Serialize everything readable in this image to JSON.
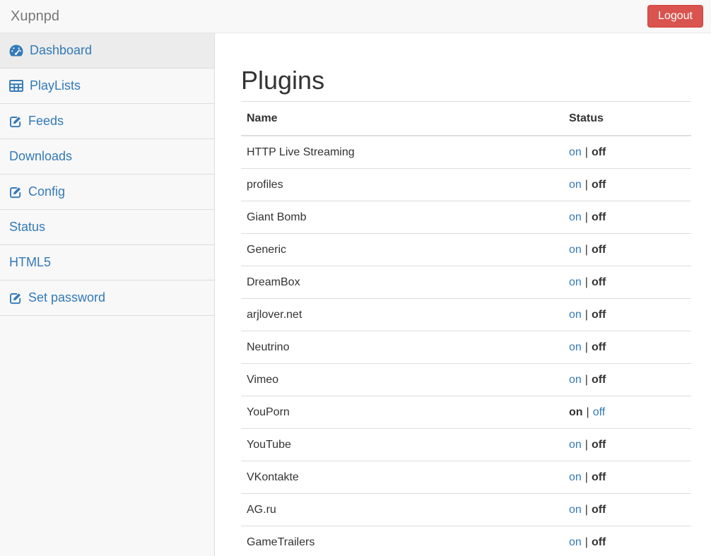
{
  "header": {
    "brand": "Xupnpd",
    "logout_label": "Logout"
  },
  "sidebar": {
    "items": [
      {
        "label": "Dashboard",
        "icon": "dashboard-icon",
        "active": true
      },
      {
        "label": "PlayLists",
        "icon": "table-icon",
        "active": false
      },
      {
        "label": "Feeds",
        "icon": "edit-icon",
        "active": false
      },
      {
        "label": "Downloads",
        "icon": "",
        "active": false
      },
      {
        "label": "Config",
        "icon": "edit-icon",
        "active": false
      },
      {
        "label": "Status",
        "icon": "",
        "active": false
      },
      {
        "label": "HTML5",
        "icon": "",
        "active": false
      },
      {
        "label": "Set password",
        "icon": "edit-icon",
        "active": false
      }
    ]
  },
  "main": {
    "title": "Plugins",
    "table": {
      "columns": [
        "Name",
        "Status"
      ],
      "on_label": "on",
      "off_label": "off",
      "separator": "|",
      "rows": [
        {
          "name": "HTTP Live Streaming",
          "enabled": false
        },
        {
          "name": "profiles",
          "enabled": false
        },
        {
          "name": "Giant Bomb",
          "enabled": false
        },
        {
          "name": "Generic",
          "enabled": false
        },
        {
          "name": "DreamBox",
          "enabled": false
        },
        {
          "name": "arjlover.net",
          "enabled": false
        },
        {
          "name": "Neutrino",
          "enabled": false
        },
        {
          "name": "Vimeo",
          "enabled": false
        },
        {
          "name": "YouPorn",
          "enabled": true
        },
        {
          "name": "YouTube",
          "enabled": false
        },
        {
          "name": "VKontakte",
          "enabled": false
        },
        {
          "name": "AG.ru",
          "enabled": false
        },
        {
          "name": "GameTrailers",
          "enabled": false
        }
      ]
    }
  },
  "colors": {
    "accent_link": "#337ab7",
    "danger_bg": "#d9534f",
    "danger_border": "#d43f3a",
    "navbar_bg": "#f8f8f8",
    "sidebar_bg": "#f8f8f8",
    "sidebar_active_bg": "#ececec",
    "border": "#dddddd",
    "text": "#333333",
    "brand_text": "#777777"
  }
}
